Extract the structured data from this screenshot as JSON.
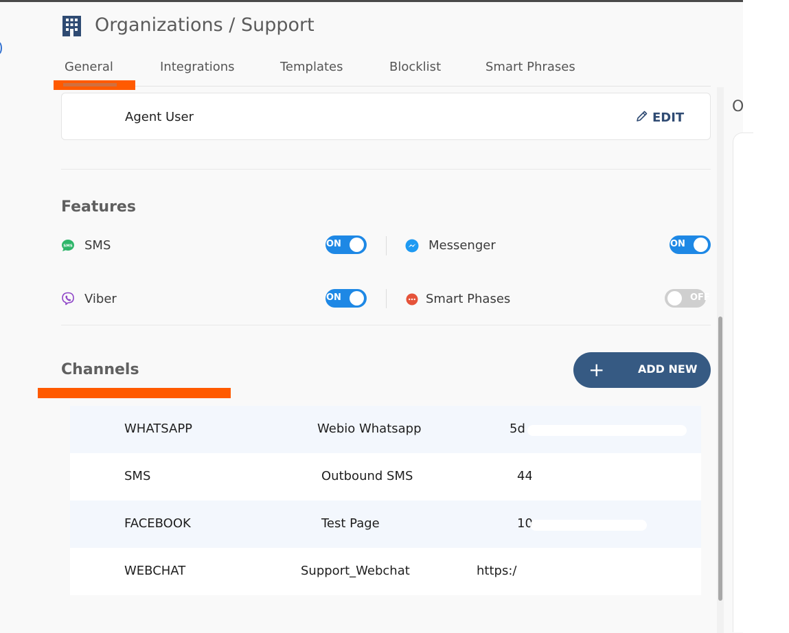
{
  "header": {
    "title": "Organizations / Support",
    "icon": "building-icon"
  },
  "tabs": [
    {
      "label": "General",
      "active": true
    },
    {
      "label": "Integrations",
      "active": false
    },
    {
      "label": "Templates",
      "active": false
    },
    {
      "label": "Blocklist",
      "active": false
    },
    {
      "label": "Smart Phrases",
      "active": false
    }
  ],
  "agent": {
    "name": "Agent User",
    "edit_label": "EDIT"
  },
  "features": {
    "title": "Features",
    "items": [
      {
        "label": "SMS",
        "icon": "sms-icon",
        "toggle": "ON",
        "enabled": true
      },
      {
        "label": "Messenger",
        "icon": "messenger-icon",
        "toggle": "ON",
        "enabled": true
      },
      {
        "label": "Viber",
        "icon": "viber-icon",
        "toggle": "ON",
        "enabled": true
      },
      {
        "label": "Smart Phases",
        "icon": "smart-phases-icon",
        "toggle": "OFF",
        "enabled": false
      }
    ]
  },
  "channels": {
    "title": "Channels",
    "add_label": "ADD NEW",
    "add_icon": "+",
    "rows": [
      {
        "type": "WHATSAPP",
        "name": "Webio Whatsapp",
        "id": "5d"
      },
      {
        "type": "SMS",
        "name": "Outbound SMS",
        "id": "44"
      },
      {
        "type": "FACEBOOK",
        "name": "Test Page",
        "id": "10"
      },
      {
        "type": "WEBCHAT",
        "name": "Support_Webchat",
        "id": "https:/"
      }
    ]
  },
  "right_panel": {
    "letter": "O"
  },
  "colors": {
    "accent": "#ff5a00",
    "primary_button": "#365a83",
    "toggle_on": "#1e88e5",
    "toggle_off": "#cfcfcf",
    "edit_text": "#2f4b73"
  }
}
